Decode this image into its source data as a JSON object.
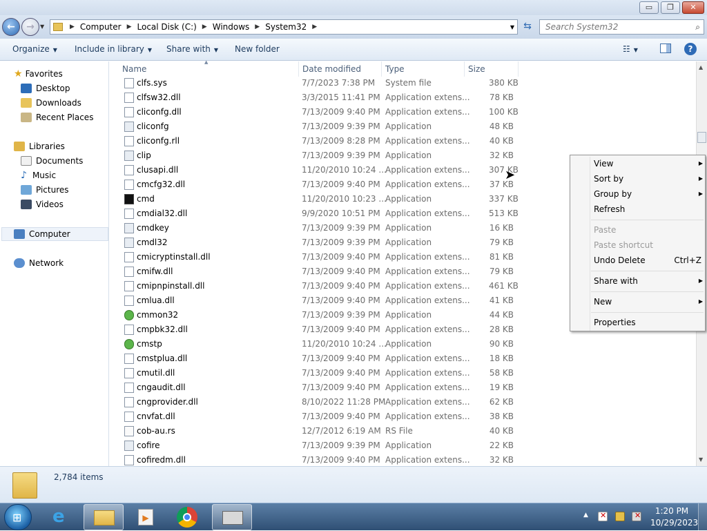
{
  "window": {
    "minimize_glyph": "▭",
    "maximize_glyph": "❐",
    "close_glyph": "✕"
  },
  "address": {
    "crumbs": [
      "Computer",
      "Local Disk (C:)",
      "Windows",
      "System32"
    ],
    "search_placeholder": "Search System32"
  },
  "toolbar": {
    "organize": "Organize",
    "include": "Include in library",
    "share": "Share with",
    "newfolder": "New folder"
  },
  "nav": {
    "favorites": "Favorites",
    "desktop": "Desktop",
    "downloads": "Downloads",
    "recent": "Recent Places",
    "libraries": "Libraries",
    "documents": "Documents",
    "music": "Music",
    "pictures": "Pictures",
    "videos": "Videos",
    "computer": "Computer",
    "network": "Network"
  },
  "columns": {
    "name": "Name",
    "date": "Date modified",
    "type": "Type",
    "size": "Size"
  },
  "files": [
    {
      "name": "clfs.sys",
      "date": "7/7/2023 7:38 PM",
      "type": "System file",
      "size": "380 KB",
      "icon": "file"
    },
    {
      "name": "clfsw32.dll",
      "date": "3/3/2015 11:41 PM",
      "type": "Application extens...",
      "size": "78 KB",
      "icon": "file"
    },
    {
      "name": "cliconfg.dll",
      "date": "7/13/2009 9:40 PM",
      "type": "Application extens...",
      "size": "100 KB",
      "icon": "file"
    },
    {
      "name": "cliconfg",
      "date": "7/13/2009 9:39 PM",
      "type": "Application",
      "size": "48 KB",
      "icon": "app"
    },
    {
      "name": "cliconfg.rll",
      "date": "7/13/2009 8:28 PM",
      "type": "Application extens...",
      "size": "40 KB",
      "icon": "file"
    },
    {
      "name": "clip",
      "date": "7/13/2009 9:39 PM",
      "type": "Application",
      "size": "32 KB",
      "icon": "app"
    },
    {
      "name": "clusapi.dll",
      "date": "11/20/2010 10:24 ...",
      "type": "Application extens...",
      "size": "307 KB",
      "icon": "file"
    },
    {
      "name": "cmcfg32.dll",
      "date": "7/13/2009 9:40 PM",
      "type": "Application extens...",
      "size": "37 KB",
      "icon": "file"
    },
    {
      "name": "cmd",
      "date": "11/20/2010 10:23 ...",
      "type": "Application",
      "size": "337 KB",
      "icon": "cmd"
    },
    {
      "name": "cmdial32.dll",
      "date": "9/9/2020 10:51 PM",
      "type": "Application extens...",
      "size": "513 KB",
      "icon": "file"
    },
    {
      "name": "cmdkey",
      "date": "7/13/2009 9:39 PM",
      "type": "Application",
      "size": "16 KB",
      "icon": "app"
    },
    {
      "name": "cmdl32",
      "date": "7/13/2009 9:39 PM",
      "type": "Application",
      "size": "79 KB",
      "icon": "app"
    },
    {
      "name": "cmicryptinstall.dll",
      "date": "7/13/2009 9:40 PM",
      "type": "Application extens...",
      "size": "81 KB",
      "icon": "file"
    },
    {
      "name": "cmifw.dll",
      "date": "7/13/2009 9:40 PM",
      "type": "Application extens...",
      "size": "79 KB",
      "icon": "file"
    },
    {
      "name": "cmipnpinstall.dll",
      "date": "7/13/2009 9:40 PM",
      "type": "Application extens...",
      "size": "461 KB",
      "icon": "file"
    },
    {
      "name": "cmlua.dll",
      "date": "7/13/2009 9:40 PM",
      "type": "Application extens...",
      "size": "41 KB",
      "icon": "file"
    },
    {
      "name": "cmmon32",
      "date": "7/13/2009 9:39 PM",
      "type": "Application",
      "size": "44 KB",
      "icon": "grn"
    },
    {
      "name": "cmpbk32.dll",
      "date": "7/13/2009 9:40 PM",
      "type": "Application extens...",
      "size": "28 KB",
      "icon": "file"
    },
    {
      "name": "cmstp",
      "date": "11/20/2010 10:24 ...",
      "type": "Application",
      "size": "90 KB",
      "icon": "grn"
    },
    {
      "name": "cmstplua.dll",
      "date": "7/13/2009 9:40 PM",
      "type": "Application extens...",
      "size": "18 KB",
      "icon": "file"
    },
    {
      "name": "cmutil.dll",
      "date": "7/13/2009 9:40 PM",
      "type": "Application extens...",
      "size": "58 KB",
      "icon": "file"
    },
    {
      "name": "cngaudit.dll",
      "date": "7/13/2009 9:40 PM",
      "type": "Application extens...",
      "size": "19 KB",
      "icon": "file"
    },
    {
      "name": "cngprovider.dll",
      "date": "8/10/2022 11:28 PM",
      "type": "Application extens...",
      "size": "62 KB",
      "icon": "file"
    },
    {
      "name": "cnvfat.dll",
      "date": "7/13/2009 9:40 PM",
      "type": "Application extens...",
      "size": "38 KB",
      "icon": "file"
    },
    {
      "name": "cob-au.rs",
      "date": "12/7/2012 6:19 AM",
      "type": "RS File",
      "size": "40 KB",
      "icon": "blank"
    },
    {
      "name": "cofire",
      "date": "7/13/2009 9:39 PM",
      "type": "Application",
      "size": "22 KB",
      "icon": "app"
    },
    {
      "name": "cofiredm.dll",
      "date": "7/13/2009 9:40 PM",
      "type": "Application extens...",
      "size": "32 KB",
      "icon": "file"
    }
  ],
  "status": {
    "count": "2,784 items"
  },
  "context_menu": {
    "view": "View",
    "sortby": "Sort by",
    "groupby": "Group by",
    "refresh": "Refresh",
    "paste": "Paste",
    "paste_shortcut": "Paste shortcut",
    "undo": "Undo Delete",
    "undo_key": "Ctrl+Z",
    "share": "Share with",
    "new": "New",
    "properties": "Properties"
  },
  "clock": {
    "time": "1:20 PM",
    "date": "10/29/2023"
  }
}
